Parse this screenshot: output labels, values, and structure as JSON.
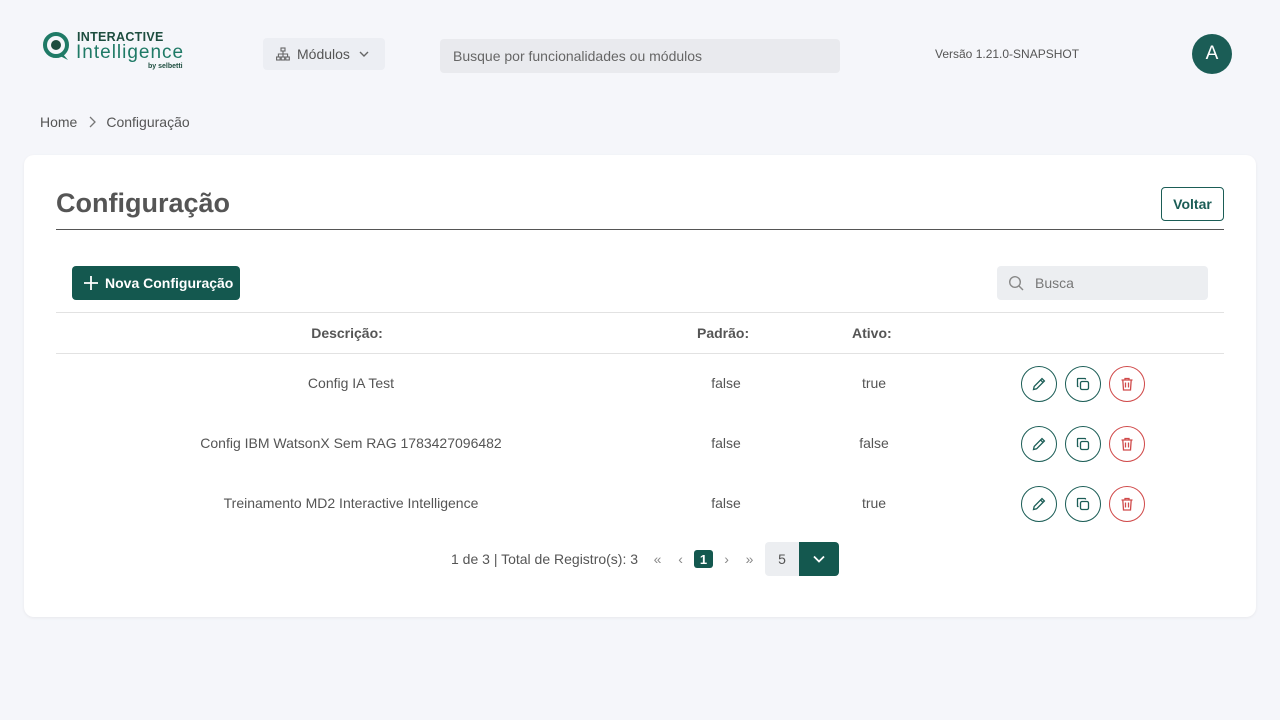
{
  "header": {
    "logo": {
      "line1": "INTERACTIVE",
      "line2": "Intelligence",
      "line3": "by selbetti"
    },
    "modules_label": "Módulos",
    "search_placeholder": "Busque por funcionalidades ou módulos",
    "version": "Versão 1.21.0-SNAPSHOT",
    "avatar_initial": "A"
  },
  "breadcrumb": {
    "home": "Home",
    "current": "Configuração"
  },
  "page": {
    "title": "Configuração",
    "back_label": "Voltar",
    "new_label": "Nova Configuração",
    "search_placeholder": "Busca"
  },
  "table": {
    "columns": {
      "descricao": "Descrição:",
      "padrao": "Padrão:",
      "ativo": "Ativo:"
    },
    "rows": [
      {
        "descricao": "Config IA Test",
        "padrao": "false",
        "ativo": "true"
      },
      {
        "descricao": "Config IBM WatsonX Sem RAG 1783427096482",
        "padrao": "false",
        "ativo": "false"
      },
      {
        "descricao": "Treinamento MD2 Interactive Intelligence",
        "padrao": "false",
        "ativo": "true"
      }
    ]
  },
  "pagination": {
    "info": "1 de 3 | Total de Registro(s): 3",
    "first": "«",
    "prev": "‹",
    "current_page": "1",
    "next": "›",
    "last": "»",
    "page_size": "5"
  },
  "colors": {
    "primary": "#14584f",
    "danger": "#d04a4a",
    "background": "#f5f6fa"
  },
  "icons": [
    "org-icon",
    "chevron-down-icon",
    "chevron-right-icon",
    "plus-icon",
    "search-icon",
    "edit-icon",
    "copy-icon",
    "trash-icon"
  ]
}
